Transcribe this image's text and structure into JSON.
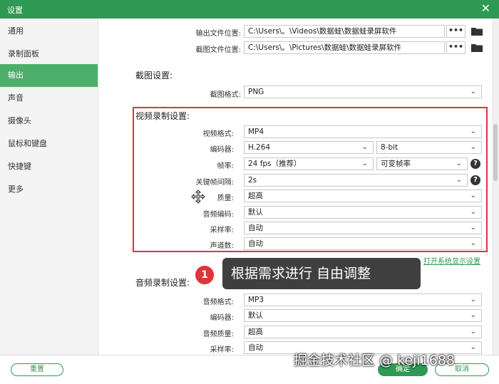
{
  "window": {
    "title": "设置",
    "close_glyph": "✕"
  },
  "sidebar": {
    "items": [
      {
        "label": "通用"
      },
      {
        "label": "录制面板"
      },
      {
        "label": "输出"
      },
      {
        "label": "声音"
      },
      {
        "label": "摄像头"
      },
      {
        "label": "鼠标和键盘"
      },
      {
        "label": "快捷键"
      },
      {
        "label": "更多"
      }
    ],
    "active_index": 2
  },
  "output_paths": {
    "video_label": "输出文件位置:",
    "video_path": "C:\\Users\\。\\Videos\\数据蛙\\数据蛙录屏软件",
    "shot_label": "截图文件位置:",
    "shot_path": "C:\\Users\\。\\Pictures\\数据蛙\\数据蛙录屏软件",
    "dots": "•••"
  },
  "screenshot": {
    "section_title": "截图设置:",
    "format_label": "截图格式:",
    "format_value": "PNG"
  },
  "video": {
    "section_title": "视频录制设置:",
    "format_label": "视频格式:",
    "format_value": "MP4",
    "encoder_label": "编码器:",
    "encoder_value": "H.264",
    "bitdepth_value": "8-bit",
    "fps_label": "帧率:",
    "fps_value": "24 fps（推荐）",
    "fps_mode_value": "可变帧率",
    "keyframe_label": "关键帧间隔:",
    "keyframe_value": "2s",
    "quality_label": "质量:",
    "quality_value": "超高",
    "audio_enc_label": "音频编码:",
    "audio_enc_value": "默认",
    "sample_label": "采样率:",
    "sample_value": "自动",
    "channels_label": "声道数:",
    "channels_value": "自动",
    "help_glyph": "?"
  },
  "display_link": "打开系统显示设置",
  "audio": {
    "section_title": "音频录制设置:",
    "format_label": "音频格式:",
    "format_value": "MP3",
    "encoder_label": "编码器:",
    "encoder_value": "默认",
    "quality_label": "音频质量:",
    "quality_value": "超高",
    "sample_label": "采样率:",
    "sample_value": "自动"
  },
  "footer": {
    "reset": "重置",
    "ok": "确定",
    "cancel": "取消"
  },
  "callout": {
    "number": "1",
    "text": "根据需求进行 自由调整"
  },
  "watermark": "掘金技术社区 @ keji1688",
  "colors": {
    "accent": "#2e9a54",
    "highlight": "#e0343b"
  }
}
